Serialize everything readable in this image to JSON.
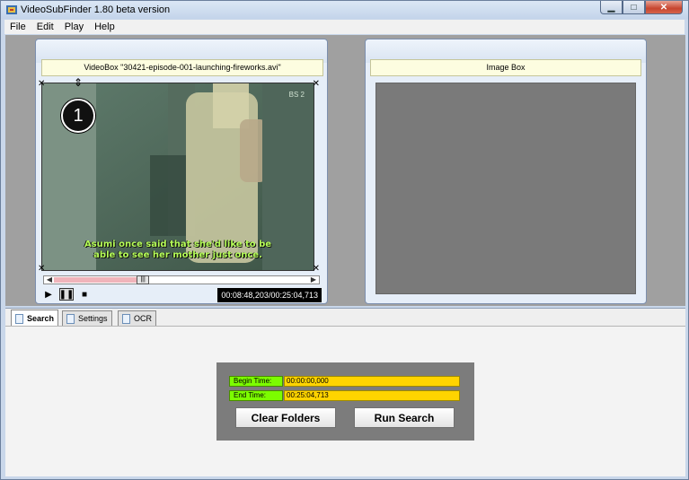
{
  "window": {
    "title": "VideoSubFinder 1.80 beta version",
    "icons": {
      "app": "app-icon",
      "minimize": "minimize-icon",
      "maximize": "maximize-icon",
      "close": "close-icon"
    }
  },
  "menu": {
    "items": [
      "File",
      "Edit",
      "Play",
      "Help"
    ]
  },
  "video_box": {
    "title": "VideoBox \"30421-episode-001-launching-fireworks.avi\"",
    "frame_badge": "1",
    "subtitle_line1": "Asumi once said that she'd like to be",
    "subtitle_line2": "able to see her mother just once.",
    "corner_mark": "BS 2",
    "seek_progress_fraction": 0.35,
    "timecode": "00:08:48,203/00:25:04,713",
    "controls": {
      "play": "play-icon",
      "pause": "pause-icon",
      "stop": "stop-icon"
    }
  },
  "image_box": {
    "title": "Image Box"
  },
  "tabs": [
    {
      "label": "Search",
      "active": true
    },
    {
      "label": "Settings",
      "active": false
    },
    {
      "label": "OCR",
      "active": false
    }
  ],
  "search": {
    "begin_label": "Begin Time:",
    "begin_value": "00:00:00,000",
    "end_label": "End Time:",
    "end_value": "00:25:04,713",
    "clear_button": "Clear Folders",
    "run_button": "Run Search"
  },
  "colors": {
    "time_label_bg": "#7cfc00",
    "time_value_bg": "#ffd400",
    "subtitle_text": "#b6ff58",
    "timecode_bg": "#000000"
  }
}
